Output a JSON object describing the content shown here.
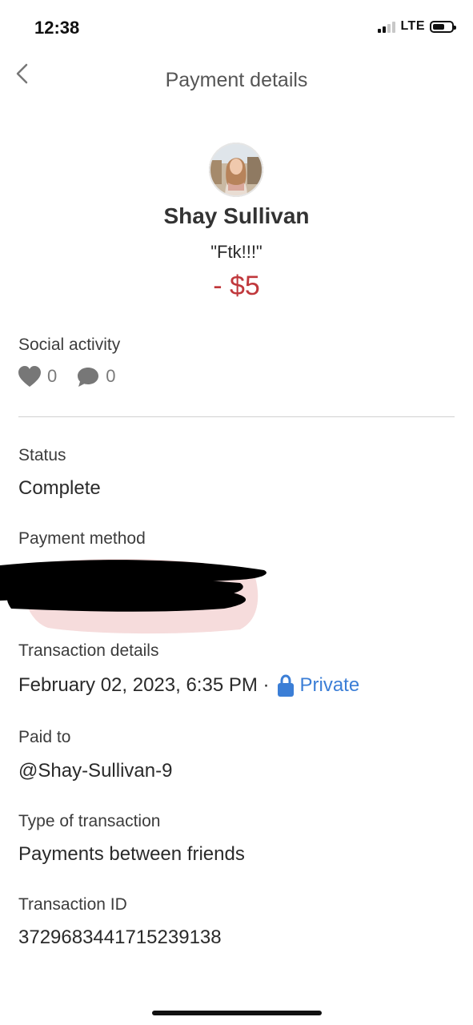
{
  "status_bar": {
    "time": "12:38",
    "network": "LTE"
  },
  "header": {
    "title": "Payment details"
  },
  "profile": {
    "name": "Shay Sullivan",
    "note": "\"Ftk!!!\"",
    "amount": "- $5"
  },
  "social": {
    "label": "Social activity",
    "likes": "0",
    "comments": "0"
  },
  "status": {
    "label": "Status",
    "value": "Complete"
  },
  "payment_method": {
    "label": "Payment method"
  },
  "transaction_details": {
    "label": "Transaction details",
    "date": "February 02, 2023, 6:35 PM ·",
    "privacy": "Private"
  },
  "paid_to": {
    "label": "Paid to",
    "value": "@Shay-Sullivan-9"
  },
  "transaction_type": {
    "label": "Type of transaction",
    "value": "Payments between friends"
  },
  "transaction_id": {
    "label": "Transaction ID",
    "value": "3729683441715239138"
  },
  "colors": {
    "amount": "#c0383c",
    "link": "#3b7ed6",
    "redaction": "#000000",
    "redaction_halo": "#f6dcdc"
  },
  "icons": [
    "chevron-left-icon",
    "heart-icon",
    "comment-icon",
    "lock-icon"
  ]
}
